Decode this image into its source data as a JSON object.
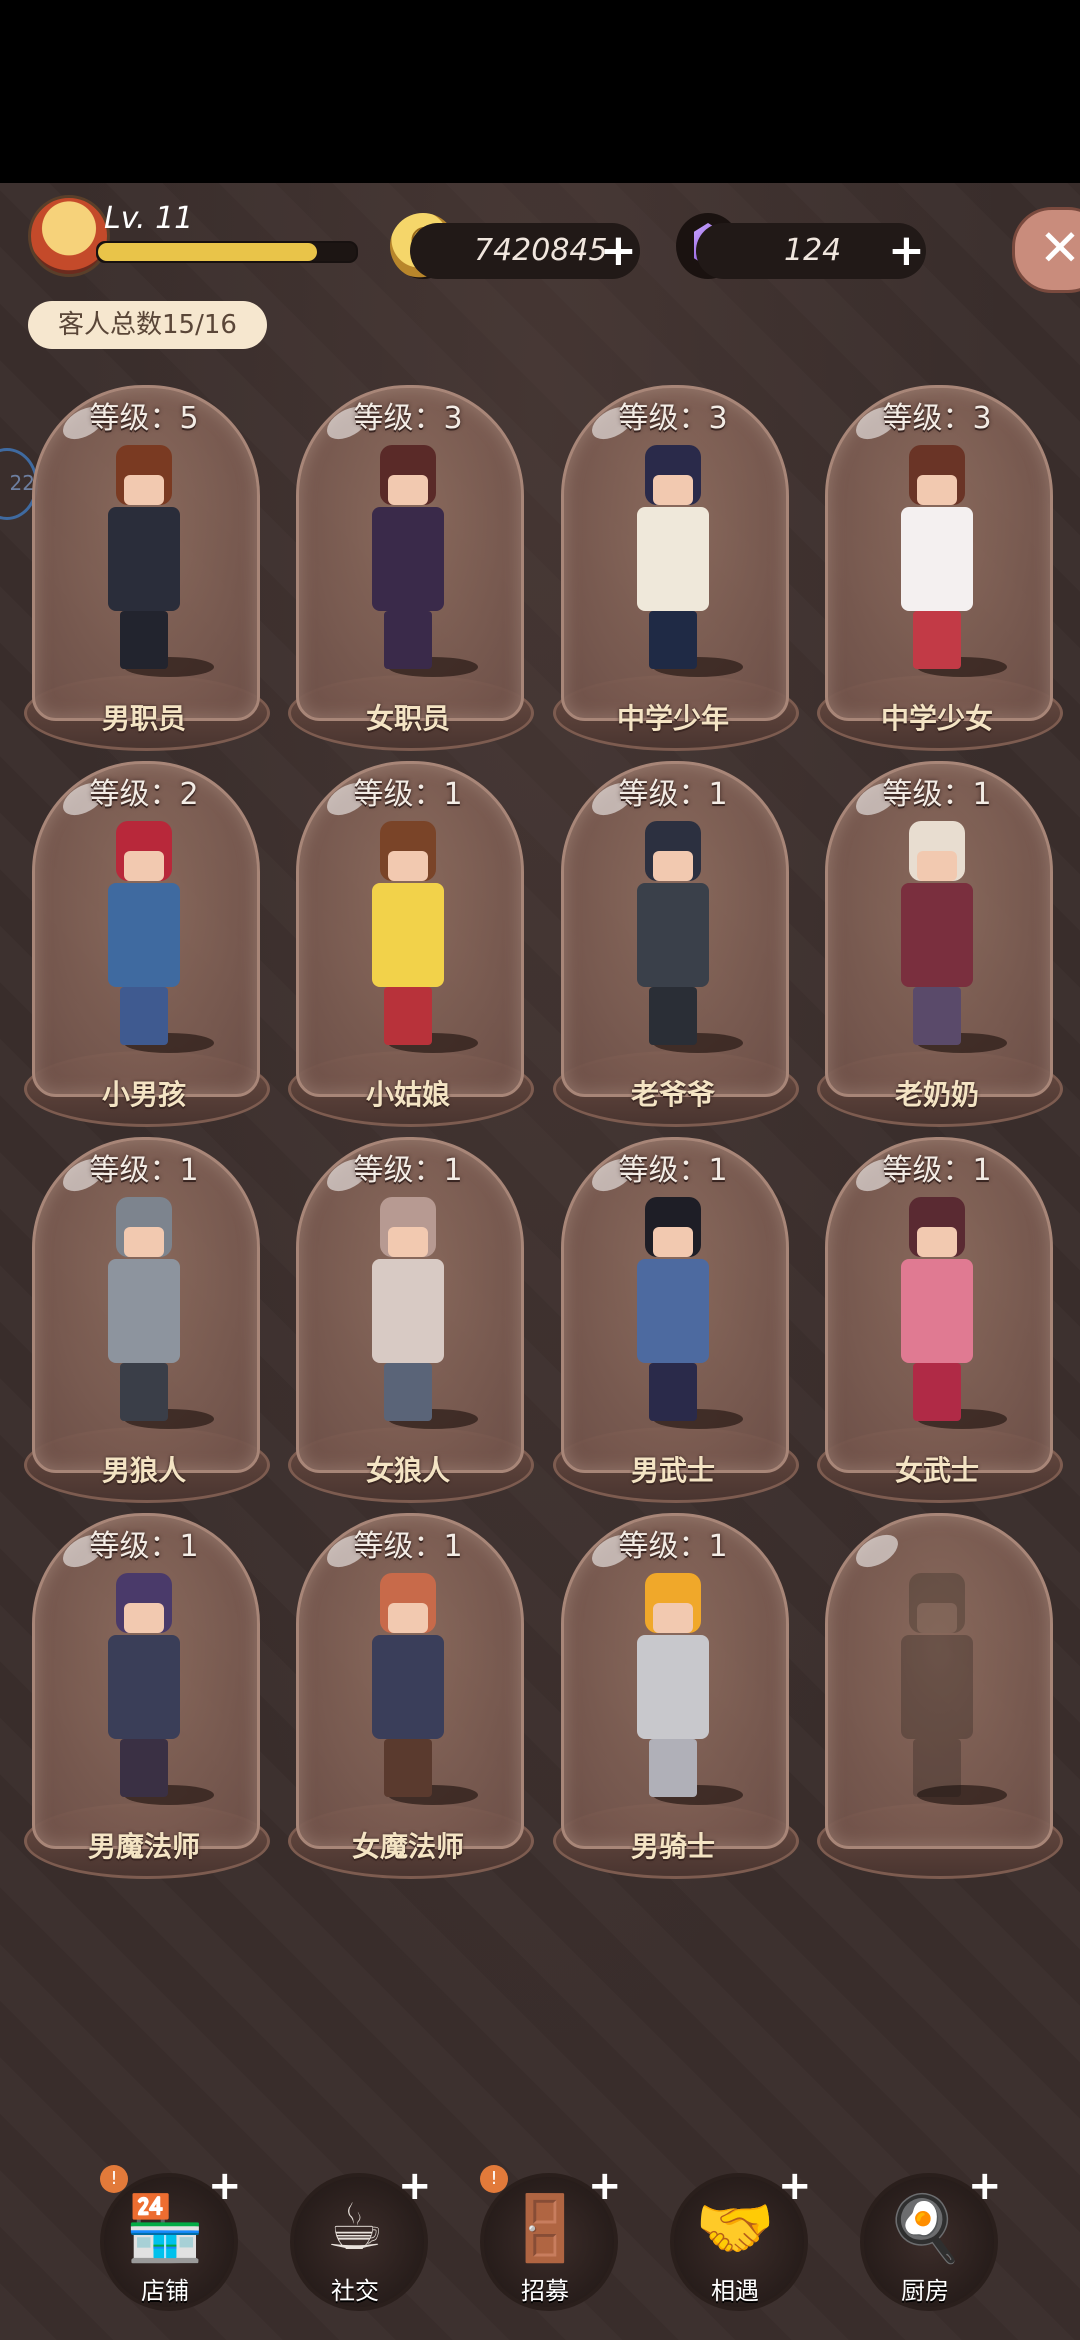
{
  "hud": {
    "level_label": "Lv. 11",
    "xp_fraction": 0.85,
    "coins": "7420845",
    "gems": "124",
    "plus": "+",
    "close": "✕"
  },
  "customer_total": "客人总数15/16",
  "side_tab": "22",
  "customers": [
    {
      "level": "等级：5",
      "name": "男职员",
      "hair": "#7a3a22",
      "top": "#2a2d3a",
      "legs": "#22242e"
    },
    {
      "level": "等级：3",
      "name": "女职员",
      "hair": "#5a2a28",
      "top": "#3a2a4a",
      "legs": "#3a2a4a"
    },
    {
      "level": "等级：3",
      "name": "中学少年",
      "hair": "#2a2a4a",
      "top": "#efe8da",
      "legs": "#1f2a45"
    },
    {
      "level": "等级：3",
      "name": "中学少女",
      "hair": "#6a3426",
      "top": "#f4f0f0",
      "legs": "#c23a46"
    },
    {
      "level": "等级：2",
      "name": "小男孩",
      "hair": "#b8283a",
      "top": "#3f6aa0",
      "legs": "#3f5a90"
    },
    {
      "level": "等级：1",
      "name": "小姑娘",
      "hair": "#7a4428",
      "top": "#f2d24a",
      "legs": "#b8323a"
    },
    {
      "level": "等级：1",
      "name": "老爷爷",
      "hair": "#2c3040",
      "top": "#3a404a",
      "legs": "#2a2e36"
    },
    {
      "level": "等级：1",
      "name": "老奶奶",
      "hair": "#e8ddd0",
      "top": "#7a2f3e",
      "legs": "#5a4a6a"
    },
    {
      "level": "等级：1",
      "name": "男狼人",
      "hair": "#7d848e",
      "top": "#8d949e",
      "legs": "#3a3e48"
    },
    {
      "level": "等级：1",
      "name": "女狼人",
      "hair": "#b79a92",
      "top": "#d8cac4",
      "legs": "#5a6478"
    },
    {
      "level": "等级：1",
      "name": "男武士",
      "hair": "#1e1e26",
      "top": "#4d6aa0",
      "legs": "#2a2a4a"
    },
    {
      "level": "等级：1",
      "name": "女武士",
      "hair": "#5a2a32",
      "top": "#e07a92",
      "legs": "#b02a46"
    },
    {
      "level": "等级：1",
      "name": "男魔法师",
      "hair": "#4a3a6a",
      "top": "#3a3e58",
      "legs": "#3a3044"
    },
    {
      "level": "等级：1",
      "name": "女魔法师",
      "hair": "#c86a4a",
      "top": "#3a3e5a",
      "legs": "#5a3a2e"
    },
    {
      "level": "等级：1",
      "name": "男骑士",
      "hair": "#f0a82a",
      "top": "#c8c8cc",
      "legs": "#b0b0b8"
    },
    {
      "level": "",
      "name": "",
      "hair": "#3a3a2a",
      "top": "#2a2622",
      "legs": "#2a2622",
      "locked": true
    }
  ],
  "nav": [
    {
      "label": "店铺",
      "icon": "shop-icon",
      "glyph": "🏪",
      "alert": true
    },
    {
      "label": "社交",
      "icon": "coffee-cup-icon",
      "glyph": "☕",
      "alert": false
    },
    {
      "label": "招募",
      "icon": "recruit-door-icon",
      "glyph": "🚪",
      "alert": true
    },
    {
      "label": "相遇",
      "icon": "handshake-icon",
      "glyph": "🤝",
      "alert": false
    },
    {
      "label": "厨房",
      "icon": "frying-pan-icon",
      "glyph": "🍳",
      "alert": false
    }
  ],
  "nav_alert_text": "!"
}
